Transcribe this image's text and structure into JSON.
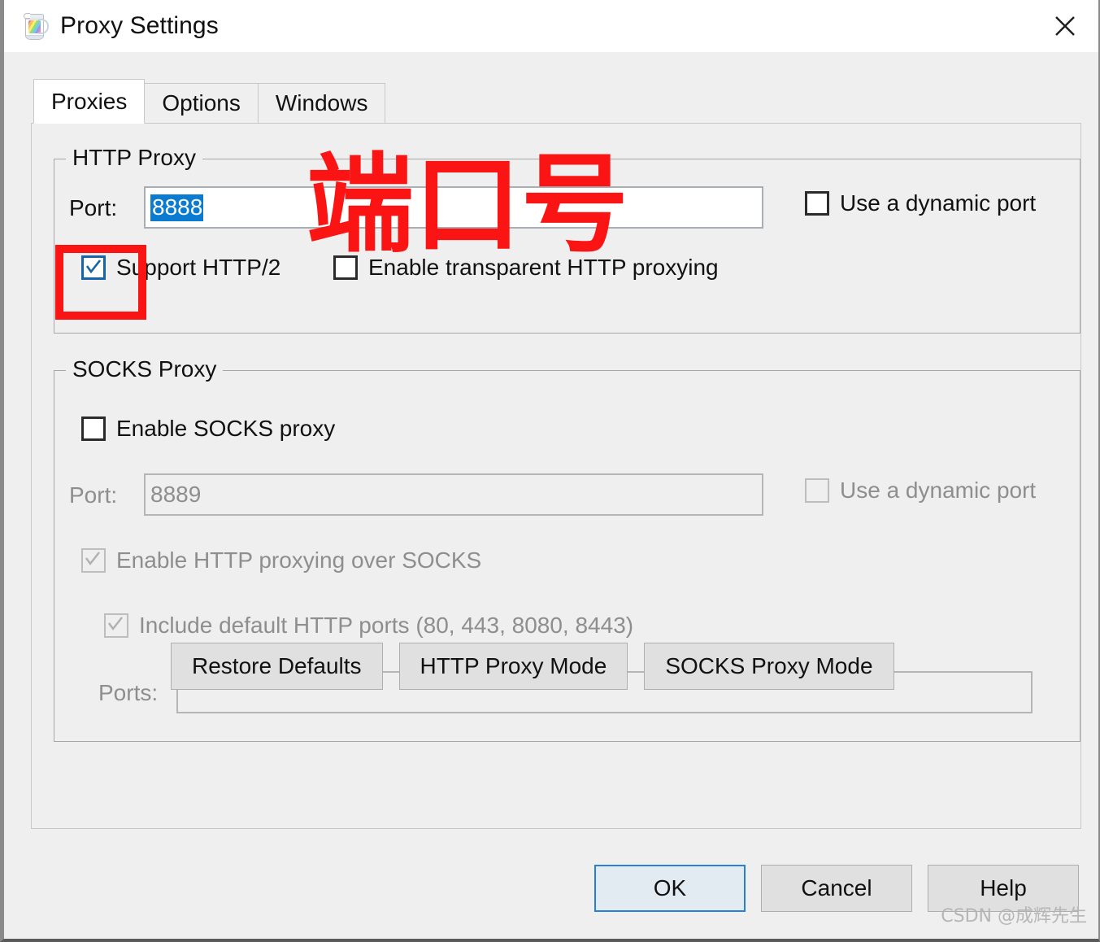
{
  "window": {
    "title": "Proxy Settings",
    "icon": "charles-pitcher-icon",
    "close_label": "✕"
  },
  "tabs": [
    {
      "label": "Proxies",
      "active": true
    },
    {
      "label": "Options",
      "active": false
    },
    {
      "label": "Windows",
      "active": false
    }
  ],
  "http_proxy": {
    "group_title": "HTTP Proxy",
    "port_label": "Port:",
    "port_value": "8888",
    "port_selected": true,
    "dynamic_port_label": "Use a dynamic port",
    "dynamic_port_checked": false,
    "support_http2_label": "Support HTTP/2",
    "support_http2_checked": true,
    "transparent_label": "Enable transparent HTTP proxying",
    "transparent_checked": false
  },
  "socks_proxy": {
    "group_title": "SOCKS Proxy",
    "enable_label": "Enable SOCKS proxy",
    "enable_checked": false,
    "port_label": "Port:",
    "port_value": "8889",
    "port_disabled": true,
    "dynamic_port_label": "Use a dynamic port",
    "dynamic_port_checked": false,
    "dynamic_port_disabled": true,
    "http_over_socks_label": "Enable HTTP proxying over SOCKS",
    "http_over_socks_checked": true,
    "http_over_socks_disabled": true,
    "include_default_ports_label": "Include default HTTP ports (80, 443, 8080, 8443)",
    "include_default_ports_checked": true,
    "include_default_ports_disabled": true,
    "ports_label": "Ports:",
    "ports_value": "",
    "ports_disabled": true
  },
  "mode_buttons": {
    "restore_defaults": "Restore Defaults",
    "http_proxy_mode": "HTTP Proxy Mode",
    "socks_proxy_mode": "SOCKS Proxy Mode"
  },
  "dialog_buttons": {
    "ok": "OK",
    "cancel": "Cancel",
    "help": "Help",
    "default_button": "ok"
  },
  "annotations": {
    "red_text": "端口号",
    "red_text_color": "#FA1414",
    "red_box_target": "support-http2-checkbox"
  },
  "watermark": "CSDN @成辉先生",
  "colors": {
    "accent_blue": "#0A7BD0",
    "focus_blue": "#2A7FD4",
    "dialog_bg": "#EFEFEF",
    "titlebar_bg": "#FFFFFF",
    "field_bg": "#FFFFFF",
    "disabled_text": "#8E8E8E",
    "annotation_red": "#FA1414"
  }
}
